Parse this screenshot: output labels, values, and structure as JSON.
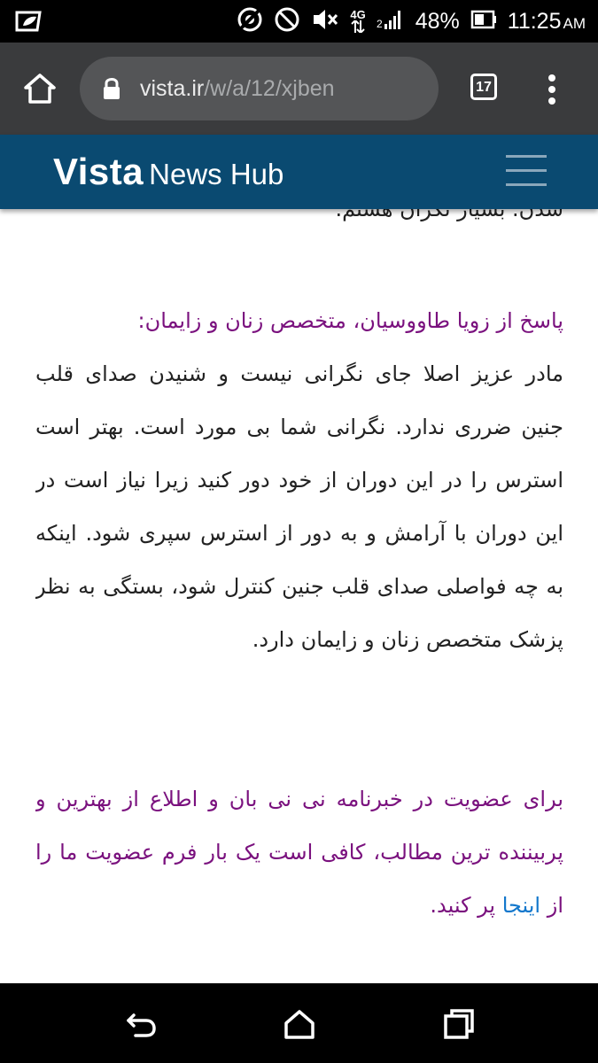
{
  "status_bar": {
    "battery": "48%",
    "time": "11:25",
    "ampm": "AM",
    "network": "4G",
    "icons": [
      "message-notification-icon",
      "hotspot-icon",
      "do-not-disturb-icon",
      "volume-muted-icon",
      "network-4g-icon",
      "signal-icon",
      "battery-icon"
    ]
  },
  "browser": {
    "url_domain": "vista.ir",
    "url_path": "/w/a/12/xjben",
    "tab_count": "17",
    "icons": [
      "home-icon",
      "lock-icon",
      "tabs-icon",
      "more-menu-icon"
    ]
  },
  "site": {
    "brand_main": "Vista",
    "brand_sub": "News Hub",
    "icons": [
      "hamburger-menu-icon"
    ]
  },
  "article": {
    "cut_line": "شدن. بسیار نگران هستم.",
    "answer_heading": "پاسخ از زویا طاووسیان، متخصص زنان و زایمان:",
    "answer_body": "مادر عزیز اصلا جای نگرانی نیست و شنیدن صدای قلب جنین ضرری ندارد. نگرانی شما بی مورد است. بهتر است استرس را در این دوران از خود دور کنید زیرا نیاز است در این دوران با آرامش و به دور از استرس سپری شود. اینکه به چه فواصلی صدای قلب جنین کنترل شود، بستگی به نظر پزشک متخصص زنان و زایمان دارد.",
    "cta_before": "برای عضویت در خبرنامه نی نی بان و اطلاع از بهترین و پربیننده ترین مطالب، کافی است یک بار فرم عضویت ما را از",
    "cta_link": "اینجا",
    "cta_after": "پر کنید."
  },
  "colors": {
    "status_bar_bg": "#000000",
    "chrome_bg": "#3a3b3d",
    "header_bg": "#0a4a71",
    "accent_purple": "#7a117e",
    "link_blue": "#1277cc",
    "body_text": "#222222"
  },
  "nav_bar": {
    "icons": [
      "back-icon",
      "home-nav-icon",
      "recents-icon"
    ]
  }
}
